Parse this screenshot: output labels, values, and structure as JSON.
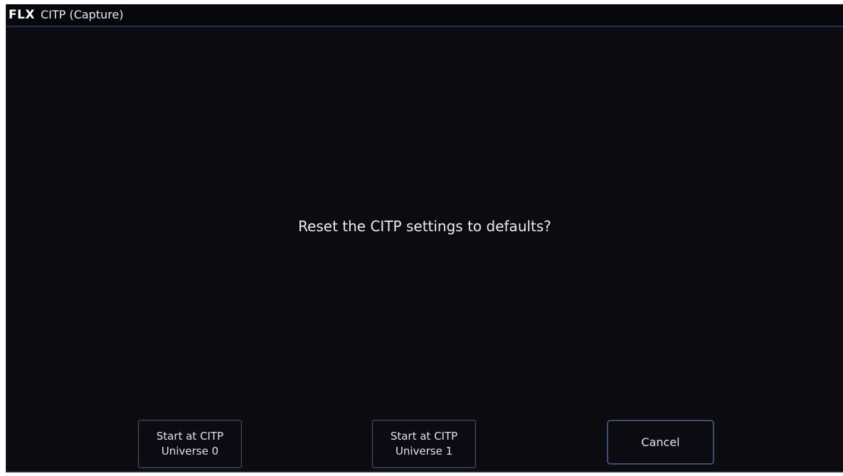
{
  "window": {
    "logo": "FLX",
    "title": "CITP (Capture)"
  },
  "dialog": {
    "message": "Reset the CITP settings to defaults?",
    "buttons": {
      "universe0": {
        "line1": "Start at CITP",
        "line2": "Universe 0"
      },
      "universe1": {
        "line1": "Start at CITP",
        "line2": "Universe 1"
      },
      "cancel": "Cancel"
    }
  }
}
